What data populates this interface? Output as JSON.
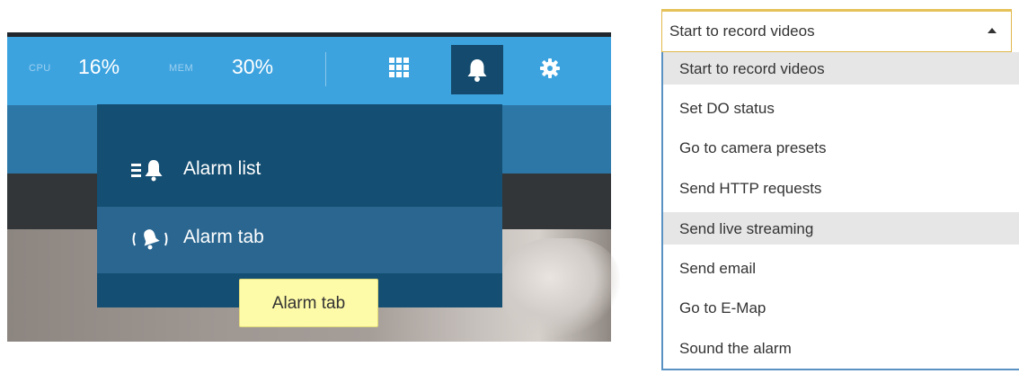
{
  "header": {
    "cpu_label": "CPU",
    "cpu_value": "16%",
    "mem_label": "MEM",
    "mem_value": "30%"
  },
  "alarm_menu": {
    "items": [
      {
        "label": "Alarm list",
        "icon": "alarm-list-icon"
      },
      {
        "label": "Alarm tab",
        "icon": "alarm-tab-icon"
      }
    ],
    "tooltip": "Alarm tab"
  },
  "icons": {
    "layout": "grid-icon",
    "alarm": "bell-icon",
    "settings": "gear-icon"
  },
  "colors": {
    "topbar": "#3da3df",
    "menu_bg": "#144e72",
    "menu_hover": "#2a6690",
    "tooltip_bg": "#fdfaa8"
  },
  "action_select": {
    "selected": "Start to record videos",
    "options": [
      "Start to record videos",
      "Set DO status",
      "Go to camera presets",
      "Send HTTP requests",
      "Send live streaming",
      "Send email",
      "Go to E-Map",
      "Sound the alarm"
    ]
  }
}
